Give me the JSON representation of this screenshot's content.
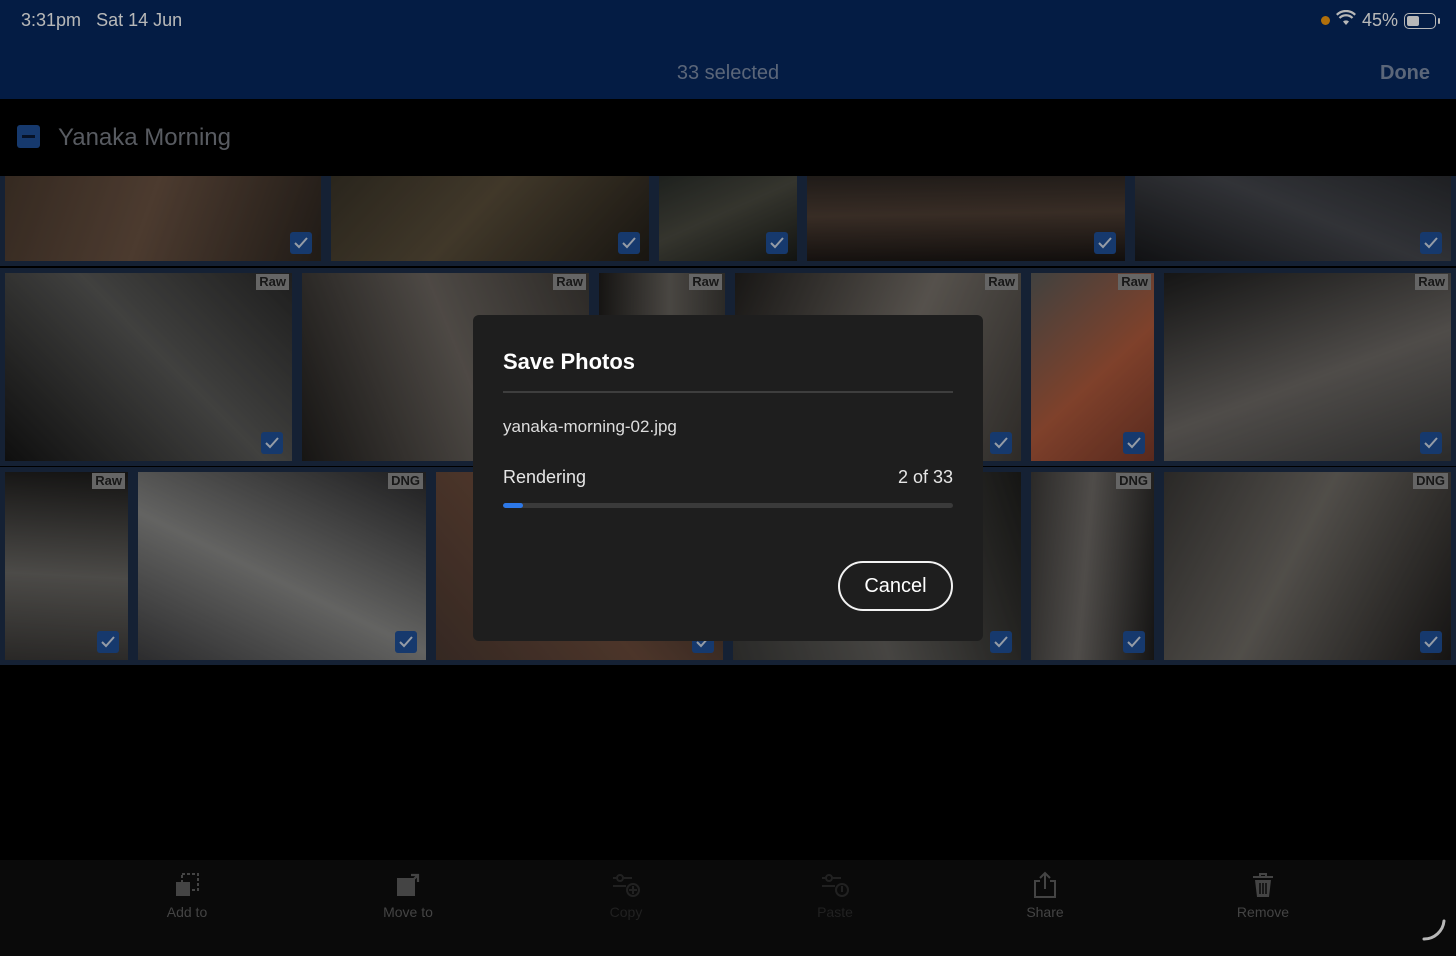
{
  "status_bar": {
    "time": "3:31pm",
    "date": "Sat 14 Jun",
    "battery": "45%",
    "battery_level": 0.45,
    "wifi_icon": "wifi-icon",
    "battery_icon": "battery-icon"
  },
  "nav": {
    "title": "33 selected",
    "done_label": "Done"
  },
  "album": {
    "title": "Yanaka Morning",
    "selection_state": "partial",
    "select_icon": "minus-checkbox-icon"
  },
  "colors": {
    "accent": "#1f4f97",
    "progress": "#2d78e8",
    "nav_bg": "#06285f",
    "dialog_bg": "#1e1e1e",
    "recording_dot": "#f59a10"
  },
  "photos": [
    {
      "badge": "",
      "selected": true
    },
    {
      "badge": "",
      "selected": true
    },
    {
      "badge": "",
      "selected": true
    },
    {
      "badge": "",
      "selected": true
    },
    {
      "badge": "",
      "selected": true
    },
    {
      "badge": "Raw",
      "selected": true
    },
    {
      "badge": "Raw",
      "selected": true
    },
    {
      "badge": "Raw",
      "selected": true
    },
    {
      "badge": "Raw",
      "selected": true
    },
    {
      "badge": "Raw",
      "selected": true
    },
    {
      "badge": "Raw",
      "selected": true
    },
    {
      "badge": "Raw",
      "selected": true
    },
    {
      "badge": "DNG",
      "selected": true
    },
    {
      "badge": "",
      "selected": true
    },
    {
      "badge": "",
      "selected": true
    },
    {
      "badge": "DNG",
      "selected": true
    },
    {
      "badge": "DNG",
      "selected": true
    },
    {
      "badge": "DNG",
      "selected": true
    }
  ],
  "dialog": {
    "title": "Save Photos",
    "filename": "yanaka-morning-02.jpg",
    "status": "Rendering",
    "count": "2 of 33",
    "progress": 0.045,
    "cancel_label": "Cancel"
  },
  "toolbar": [
    {
      "label": "Add to",
      "icon": "add-to-album-icon",
      "enabled": true
    },
    {
      "label": "Move to",
      "icon": "move-to-icon",
      "enabled": true
    },
    {
      "label": "Copy",
      "icon": "copy-settings-icon",
      "enabled": false
    },
    {
      "label": "Paste",
      "icon": "paste-settings-icon",
      "enabled": false
    },
    {
      "label": "Share",
      "icon": "share-icon",
      "enabled": true
    },
    {
      "label": "Remove",
      "icon": "trash-icon",
      "enabled": true
    }
  ]
}
